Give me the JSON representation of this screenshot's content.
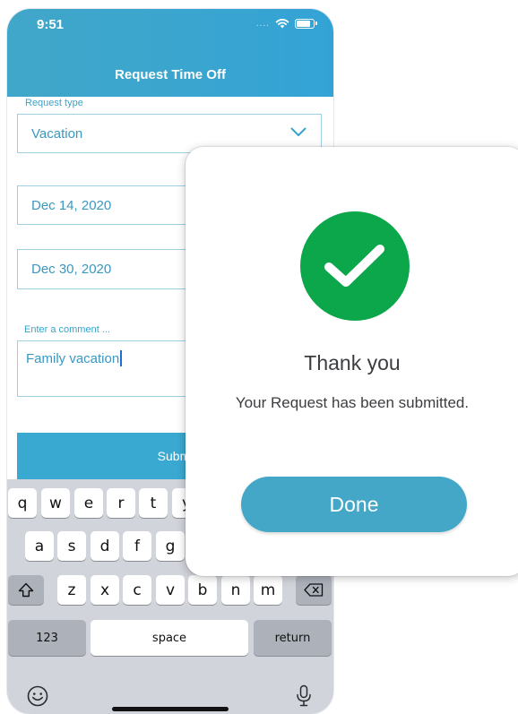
{
  "status_bar": {
    "time": "9:51",
    "signal_dots": "...."
  },
  "header": {
    "title": "Request Time Off"
  },
  "form": {
    "request_type_label": "Request type",
    "request_type_value": "Vacation",
    "start_date": "Dec 14, 2020",
    "end_date": "Dec 30, 2020",
    "comment_label": "Enter a comment ...",
    "comment_value": "Family vacation",
    "submit_label": "Submi"
  },
  "keyboard": {
    "row1": [
      "q",
      "w",
      "e",
      "r",
      "t",
      "y"
    ],
    "row2": [
      "a",
      "s",
      "d",
      "f",
      "g"
    ],
    "row3": [
      "z",
      "x",
      "c",
      "v",
      "b",
      "n",
      "m"
    ],
    "numbers_label": "123",
    "space_label": "space",
    "return_label": "return"
  },
  "dialog": {
    "title": "Thank you",
    "message": "Your Request has been submitted.",
    "done_label": "Done"
  },
  "colors": {
    "brand": "#3aa9d1",
    "success": "#0ca64b",
    "button": "#44a7c8"
  }
}
